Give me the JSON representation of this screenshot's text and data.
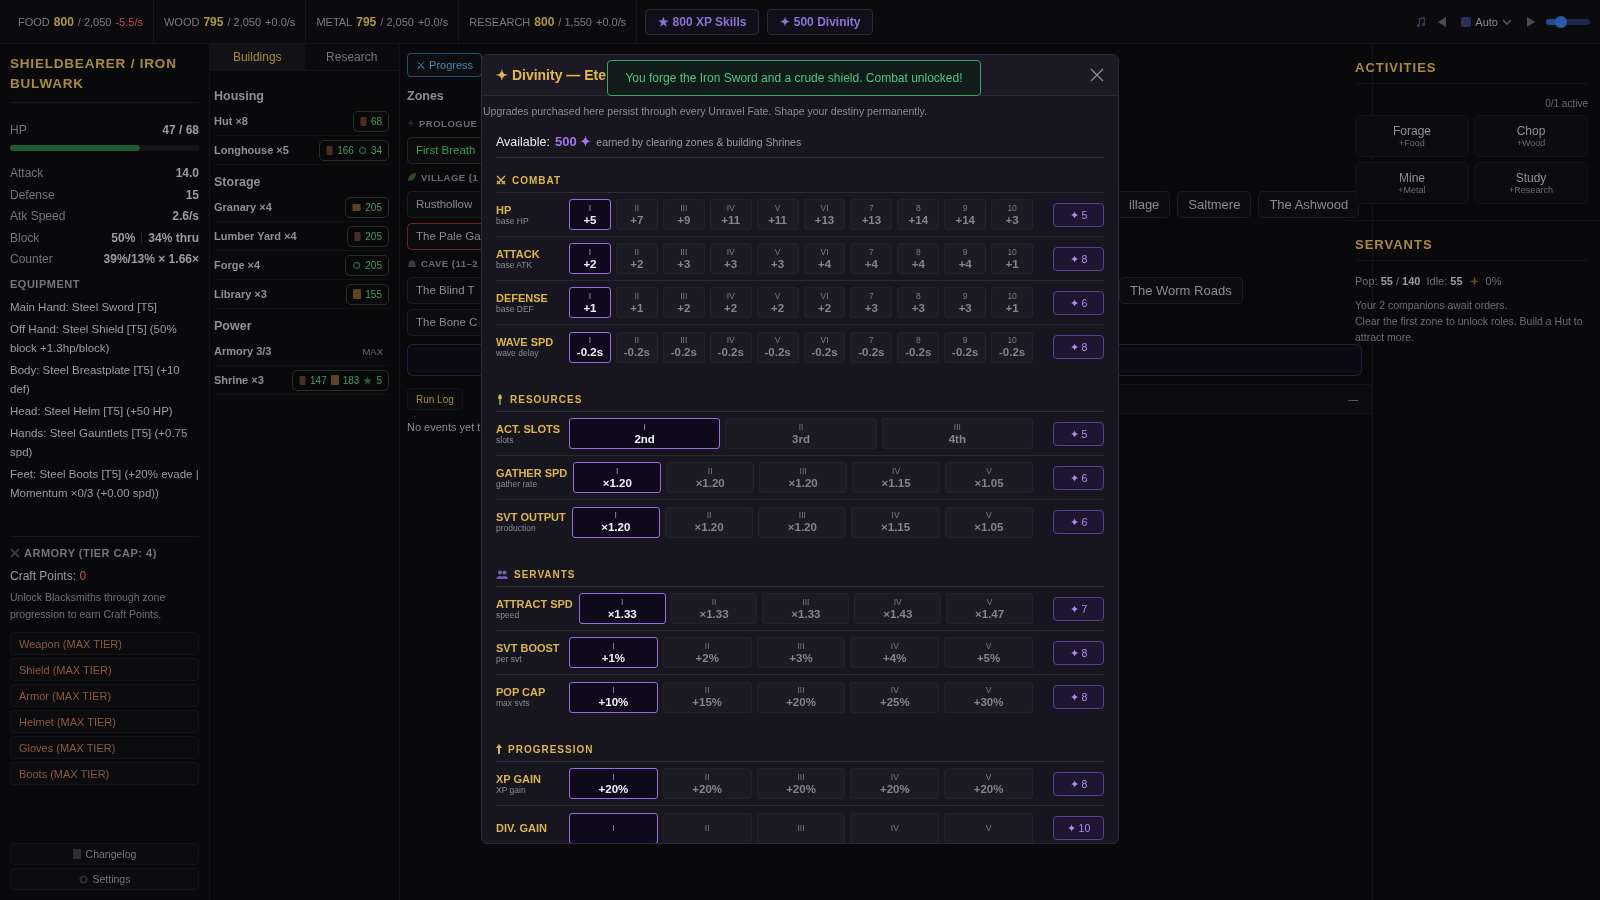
{
  "top_bar": {
    "resources": [
      {
        "label": "FOOD",
        "value": "800",
        "cap": "/ 2,050",
        "rate": "-5.5/s",
        "negative": true
      },
      {
        "label": "WOOD",
        "value": "795",
        "cap": "/ 2,050",
        "rate": "+0.0/s",
        "negative": false
      },
      {
        "label": "METAL",
        "value": "795",
        "cap": "/ 2,050",
        "rate": "+0.0/s",
        "negative": false
      },
      {
        "label": "RESEARCH",
        "value": "800",
        "cap": "/ 1,550",
        "rate": "+0.0/s",
        "negative": false
      }
    ],
    "buttons": [
      {
        "label": "★ 800 XP Skills"
      },
      {
        "label": "✦ 500 Divinity"
      }
    ],
    "speed_select": "Auto",
    "volume": {
      "level": 0.35
    }
  },
  "character": {
    "title": "SHIELDBEARER / IRON BULWARK",
    "hp": {
      "label": "HP",
      "value": "47 / 68",
      "level": 0.69
    },
    "stats": [
      {
        "label": "Attack",
        "values": [
          "14.0"
        ]
      },
      {
        "label": "Defense",
        "values": [
          "15"
        ]
      },
      {
        "label": "Atk Speed",
        "values": [
          "2.6/s"
        ]
      },
      {
        "label": "Block",
        "values": [
          "50%",
          "34% thru"
        ]
      },
      {
        "label": "Counter",
        "values": [
          "39%/13% × 1.66×"
        ]
      }
    ],
    "equipment": {
      "title": "EQUIPMENT",
      "items": [
        "Main Hand: Steel Sword [T5]",
        "Off Hand: Steel Shield [T5] (50% block +1.3hp/block)",
        "Body: Steel Breastplate [T5] (+10 def)",
        "Head: Steel Helm [T5] (+50 HP)",
        "Hands: Steel Gauntlets [T5] (+0.75 spd)",
        "Feet: Steel Boots [T5] (+20% evade | Momentum ×0/3 (+0.00 spd))"
      ]
    },
    "armory": {
      "title": "ARMORY (TIER CAP: 4)",
      "craft_label": "Craft Points:",
      "craft_points": "0",
      "hint": "Unlock Blacksmiths through zone progression to earn Craft Points.",
      "buttons": [
        {
          "label": "Weapon (MAX TIER)",
          "disabled": true
        },
        {
          "label": "Shield (MAX TIER)",
          "disabled": true
        },
        {
          "label": "Armor (MAX TIER)",
          "disabled": true
        },
        {
          "label": "Helmet (MAX TIER)",
          "disabled": true
        },
        {
          "label": "Gloves (MAX TIER)",
          "disabled": true
        },
        {
          "label": "Boots (MAX TIER)",
          "disabled": true
        }
      ]
    },
    "footer_buttons": [
      {
        "label": "Changelog"
      },
      {
        "label": "Settings"
      }
    ]
  },
  "buildings": {
    "tabs": [
      {
        "label": "Buildings",
        "selected": true
      },
      {
        "label": "Research",
        "selected": false
      }
    ],
    "groups": [
      {
        "title": "Housing",
        "items": [
          {
            "name": "Hut ×8",
            "costs": [
              {
                "kind": "wood",
                "amount": "68"
              }
            ]
          },
          {
            "name": "Longhouse ×5",
            "costs": [
              {
                "kind": "wood",
                "amount": "166"
              },
              {
                "kind": "gear",
                "amount": "34"
              }
            ]
          }
        ]
      },
      {
        "title": "Storage",
        "items": [
          {
            "name": "Granary ×4",
            "costs": [
              {
                "kind": "crate",
                "amount": "205"
              }
            ]
          },
          {
            "name": "Lumber Yard ×4",
            "costs": [
              {
                "kind": "wood",
                "amount": "205"
              }
            ]
          },
          {
            "name": "Forge ×4",
            "costs": [
              {
                "kind": "gear",
                "amount": "205"
              }
            ]
          },
          {
            "name": "Library ×3",
            "costs": [
              {
                "kind": "scroll",
                "amount": "155"
              }
            ]
          }
        ]
      },
      {
        "title": "Power",
        "items": [
          {
            "name": "Armory 3/3",
            "status": "MAX"
          },
          {
            "name": "Shrine ×3",
            "costs": [
              {
                "kind": "wood",
                "amount": "147"
              },
              {
                "kind": "scroll",
                "amount": "183"
              },
              {
                "kind": "star",
                "amount": "5"
              }
            ]
          }
        ]
      }
    ]
  },
  "zones": {
    "lines": [
      {
        "kind": "tab",
        "left": {
          "label": "⚔ Progress",
          "selected": true
        }
      },
      {
        "kind": "title",
        "left": {
          "label": "Zones"
        }
      },
      {
        "kind": "heading",
        "left": {
          "label": "PROLOGUE"
        }
      },
      {
        "kind": "zones",
        "left": [
          {
            "name": "First Breath",
            "cleared": true,
            "current": false
          }
        ]
      },
      {
        "kind": "heading",
        "left": {
          "label": "VILLAGE (1"
        }
      },
      {
        "kind": "zones",
        "left": [
          {
            "name": "Rusthollow",
            "cleared": false,
            "current": false
          }
        ],
        "right": [
          {
            "name": "illage",
            "cleared": false,
            "current": false
          },
          {
            "name": "Saltmere",
            "cleared": false,
            "current": false
          },
          {
            "name": "The Ashwood",
            "cleared": false,
            "current": false
          }
        ]
      },
      {
        "kind": "zones",
        "left": [
          {
            "name": "The Pale Ga",
            "cleared": false,
            "current": true
          }
        ]
      },
      {
        "kind": "heading",
        "left": {
          "label": "CAVE (11–2"
        }
      },
      {
        "kind": "zones",
        "left": [
          {
            "name": "The Blind T",
            "cleared": false,
            "current": false
          }
        ],
        "right": [
          {
            "name": "The Worm Roads",
            "cleared": false,
            "current": false
          }
        ]
      },
      {
        "kind": "zones",
        "left": [
          {
            "name": "The Bone C",
            "cleared": false,
            "current": false
          }
        ]
      },
      {
        "kind": "box"
      },
      {
        "kind": "runlog",
        "left": {
          "label": "Run Log",
          "selected": true
        },
        "right": {
          "label": "—"
        }
      },
      {
        "kind": "text",
        "left": {
          "label": "No events yet t"
        }
      }
    ]
  },
  "divinity_modal": {
    "title": "✦ Divinity — Ete",
    "toast": "You forge the Iron Sword and a crude shield. Combat unlocked!",
    "description": "Upgrades purchased here persist through every Unravel Fate. Shape your destiny permanently.",
    "available": {
      "label": "Available:",
      "amount": "500 ✦",
      "note": "earned by clearing zones & building Shrines"
    },
    "sections": [
      {
        "title": "COMBAT",
        "rows": [
          {
            "name": "HP",
            "sub": "base HP",
            "cost": "✦ 5",
            "tiers": [
              {
                "numeral": "I",
                "value": "+5",
                "owned": true
              },
              {
                "numeral": "II",
                "value": "+7",
                "owned": false
              },
              {
                "numeral": "III",
                "value": "+9",
                "owned": false
              },
              {
                "numeral": "IV",
                "value": "+11",
                "owned": false
              },
              {
                "numeral": "V",
                "value": "+11",
                "owned": false
              },
              {
                "numeral": "VI",
                "value": "+13",
                "owned": false
              },
              {
                "numeral": "7",
                "value": "+13",
                "owned": false
              },
              {
                "numeral": "8",
                "value": "+14",
                "owned": false
              },
              {
                "numeral": "9",
                "value": "+14",
                "owned": false
              },
              {
                "numeral": "10",
                "value": "+3",
                "owned": false
              }
            ]
          },
          {
            "name": "ATTACK",
            "sub": "base ATK",
            "cost": "✦ 8",
            "tiers": [
              {
                "numeral": "I",
                "value": "+2",
                "owned": true
              },
              {
                "numeral": "II",
                "value": "+2",
                "owned": false
              },
              {
                "numeral": "III",
                "value": "+3",
                "owned": false
              },
              {
                "numeral": "IV",
                "value": "+3",
                "owned": false
              },
              {
                "numeral": "V",
                "value": "+3",
                "owned": false
              },
              {
                "numeral": "VI",
                "value": "+4",
                "owned": false
              },
              {
                "numeral": "7",
                "value": "+4",
                "owned": false
              },
              {
                "numeral": "8",
                "value": "+4",
                "owned": false
              },
              {
                "numeral": "9",
                "value": "+4",
                "owned": false
              },
              {
                "numeral": "10",
                "value": "+1",
                "owned": false
              }
            ]
          },
          {
            "name": "DEFENSE",
            "sub": "base DEF",
            "cost": "✦ 6",
            "tiers": [
              {
                "numeral": "I",
                "value": "+1",
                "owned": true
              },
              {
                "numeral": "II",
                "value": "+1",
                "owned": false
              },
              {
                "numeral": "III",
                "value": "+2",
                "owned": false
              },
              {
                "numeral": "IV",
                "value": "+2",
                "owned": false
              },
              {
                "numeral": "V",
                "value": "+2",
                "owned": false
              },
              {
                "numeral": "VI",
                "value": "+2",
                "owned": false
              },
              {
                "numeral": "7",
                "value": "+3",
                "owned": false
              },
              {
                "numeral": "8",
                "value": "+3",
                "owned": false
              },
              {
                "numeral": "9",
                "value": "+3",
                "owned": false
              },
              {
                "numeral": "10",
                "value": "+1",
                "owned": false
              }
            ]
          },
          {
            "name": "WAVE SPD",
            "sub": "wave delay",
            "cost": "✦ 8",
            "tiers": [
              {
                "numeral": "I",
                "value": "-0.2s",
                "owned": true
              },
              {
                "numeral": "II",
                "value": "-0.2s",
                "owned": false
              },
              {
                "numeral": "III",
                "value": "-0.2s",
                "owned": false
              },
              {
                "numeral": "IV",
                "value": "-0.2s",
                "owned": false
              },
              {
                "numeral": "V",
                "value": "-0.2s",
                "owned": false
              },
              {
                "numeral": "VI",
                "value": "-0.2s",
                "owned": false
              },
              {
                "numeral": "7",
                "value": "-0.2s",
                "owned": false
              },
              {
                "numeral": "8",
                "value": "-0.2s",
                "owned": false
              },
              {
                "numeral": "9",
                "value": "-0.2s",
                "owned": false
              },
              {
                "numeral": "10",
                "value": "-0.2s",
                "owned": false
              }
            ]
          }
        ]
      },
      {
        "title": "RESOURCES",
        "rows": [
          {
            "name": "ACT. SLOTS",
            "sub": "slots",
            "cost": "✦ 5",
            "tiers": [
              {
                "numeral": "I",
                "value": "2nd",
                "owned": true
              },
              {
                "numeral": "II",
                "value": "3rd",
                "owned": false
              },
              {
                "numeral": "III",
                "value": "4th",
                "owned": false
              }
            ]
          },
          {
            "name": "GATHER SPD",
            "sub": "gather rate",
            "cost": "✦ 6",
            "tiers": [
              {
                "numeral": "I",
                "value": "×1.20",
                "owned": true
              },
              {
                "numeral": "II",
                "value": "×1.20",
                "owned": false
              },
              {
                "numeral": "III",
                "value": "×1.20",
                "owned": false
              },
              {
                "numeral": "IV",
                "value": "×1.15",
                "owned": false
              },
              {
                "numeral": "V",
                "value": "×1.05",
                "owned": false
              }
            ]
          },
          {
            "name": "SVT OUTPUT",
            "sub": "production",
            "cost": "✦ 6",
            "tiers": [
              {
                "numeral": "I",
                "value": "×1.20",
                "owned": true
              },
              {
                "numeral": "II",
                "value": "×1.20",
                "owned": false
              },
              {
                "numeral": "III",
                "value": "×1.20",
                "owned": false
              },
              {
                "numeral": "IV",
                "value": "×1.15",
                "owned": false
              },
              {
                "numeral": "V",
                "value": "×1.05",
                "owned": false
              }
            ]
          }
        ]
      },
      {
        "title": "SERVANTS",
        "rows": [
          {
            "name": "ATTRACT SPD",
            "sub": "speed",
            "cost": "✦ 7",
            "tiers": [
              {
                "numeral": "I",
                "value": "×1.33",
                "owned": true
              },
              {
                "numeral": "II",
                "value": "×1.33",
                "owned": false
              },
              {
                "numeral": "III",
                "value": "×1.33",
                "owned": false
              },
              {
                "numeral": "IV",
                "value": "×1.43",
                "owned": false
              },
              {
                "numeral": "V",
                "value": "×1.47",
                "owned": false
              }
            ]
          },
          {
            "name": "SVT BOOST",
            "sub": "per svt",
            "cost": "✦ 8",
            "tiers": [
              {
                "numeral": "I",
                "value": "+1%",
                "owned": true
              },
              {
                "numeral": "II",
                "value": "+2%",
                "owned": false
              },
              {
                "numeral": "III",
                "value": "+3%",
                "owned": false
              },
              {
                "numeral": "IV",
                "value": "+4%",
                "owned": false
              },
              {
                "numeral": "V",
                "value": "+5%",
                "owned": false
              }
            ]
          },
          {
            "name": "POP CAP",
            "sub": "max svts",
            "cost": "✦ 8",
            "tiers": [
              {
                "numeral": "I",
                "value": "+10%",
                "owned": true
              },
              {
                "numeral": "II",
                "value": "+15%",
                "owned": false
              },
              {
                "numeral": "III",
                "value": "+20%",
                "owned": false
              },
              {
                "numeral": "IV",
                "value": "+25%",
                "owned": false
              },
              {
                "numeral": "V",
                "value": "+30%",
                "owned": false
              }
            ]
          }
        ]
      },
      {
        "title": "PROGRESSION",
        "rows": [
          {
            "name": "XP GAIN",
            "sub": "XP gain",
            "cost": "✦ 8",
            "tiers": [
              {
                "numeral": "I",
                "value": "+20%",
                "owned": true
              },
              {
                "numeral": "II",
                "value": "+20%",
                "owned": false
              },
              {
                "numeral": "III",
                "value": "+20%",
                "owned": false
              },
              {
                "numeral": "IV",
                "value": "+20%",
                "owned": false
              },
              {
                "numeral": "V",
                "value": "+20%",
                "owned": false
              }
            ]
          },
          {
            "name": "DIV. GAIN",
            "cost": "✦ 10",
            "tiers": [
              {
                "numeral": "I",
                "owned": true
              },
              {
                "numeral": "II",
                "owned": false
              },
              {
                "numeral": "III",
                "owned": false
              },
              {
                "numeral": "IV",
                "owned": false
              },
              {
                "numeral": "V",
                "owned": false
              }
            ]
          }
        ]
      }
    ]
  },
  "activities": {
    "title": "ACTIVITIES",
    "count": "0/1 active",
    "items": [
      {
        "name": "Forage",
        "sub": "+Food"
      },
      {
        "name": "Chop",
        "sub": "+Wood"
      },
      {
        "name": "Mine",
        "sub": "+Metal"
      },
      {
        "name": "Study",
        "sub": "+Research"
      }
    ]
  },
  "servants": {
    "title": "SERVANTS",
    "pop": "Pop: **55** / **140**",
    "idle": "Idle: **55**",
    "rate": "0%",
    "lines": [
      "Your 2 companions await orders.",
      "Clear the first zone to unlock roles. Build a Hut to attract more."
    ]
  }
}
